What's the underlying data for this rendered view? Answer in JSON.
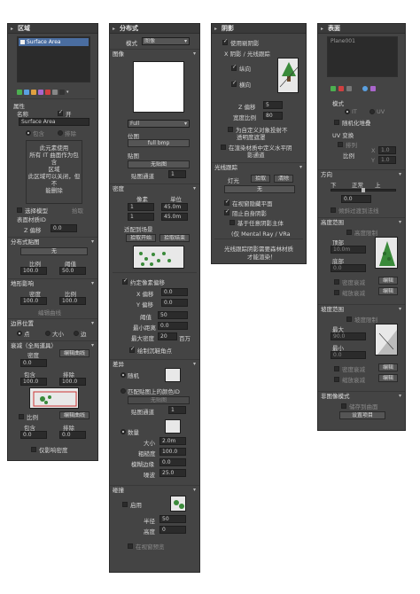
{
  "region": {
    "title": "区域",
    "list_item": "Surface Area",
    "attributes_label": "属性",
    "name_label": "名称",
    "on_label": "开",
    "name_value": "Surface Area",
    "include_label": "包含",
    "exclude_label": "排除",
    "info_lines": [
      "此元素使用",
      "所有 IT 曲面作为包含",
      "区域",
      "",
      "此区域可以关闭，但不",
      "能删除"
    ],
    "select_model_label": "选择模型",
    "pick_label": "拾取",
    "surface_id_label": "表面材质ID",
    "z_offset_label": "Z 偏移",
    "z_offset_value": "0.0",
    "distribution_map_label": "分布式贴图",
    "none_label": "无",
    "scale_label": "比例",
    "threshold_label": "阈值",
    "scale_value": "100.0",
    "threshold_value": "50.0",
    "terrain_influence_label": "地形影响",
    "density_label": "密度",
    "density_value": "100.0",
    "terrain_scale_value": "100.0",
    "edit_curve_label": "编辑曲线",
    "border_position_label": "边界位置",
    "point_label": "点",
    "size_label": "大小",
    "edge_label": "边",
    "falloff_label": "衰减（全局道具）",
    "density2_label": "密度",
    "edit_curve2_label": "编辑曲线",
    "density2_value": "0.0",
    "include2_label": "包含",
    "exclude2_label": "排除",
    "falloff_value": "100.0",
    "scale2_label": "比例",
    "edit_curve3_label": "编辑曲线",
    "include3_label": "包含",
    "exclude3_label": "排除",
    "include3_value": "0.0",
    "exclude3_value": "0.0",
    "affect_density_only_label": "仅影响密度"
  },
  "distribution": {
    "title": "分布式",
    "mode_label": "模式",
    "mode_value": "图像",
    "image_label": "图像",
    "full_label": "Full",
    "bitmap_label": "位图",
    "bitmap_value": "full bmp",
    "map_label": "贴图",
    "none_label": "无贴图",
    "map_channel_label": "贴图通道",
    "map_channel_value": "1",
    "density_section": "密度",
    "pixel_label": "像素",
    "unit_label": "单位",
    "pixel_value": "1",
    "unit_value": "45.0m",
    "pixel2_value": "1",
    "unit2_value": "45.0m",
    "fit_to_scene_label": "适配到场景",
    "pick_start_label": "拾取开始",
    "pick_end_label": "拾取结束",
    "pixel_offset_label": "约定像素偏移",
    "enable_offset_label": "约定像素偏移",
    "x_offset_label": "X 偏移",
    "y_offset_label": "Y 偏移",
    "x_offset_value": "0.0",
    "y_offset_value": "0.0",
    "threshold_label": "阈值",
    "threshold_value": "50",
    "min_dist_label": "最小距离",
    "min_dist_value": "0.0",
    "max_density_label": "最大密度",
    "max_density_value": "20",
    "million_label": "百万",
    "draw_center_label": "绘制沉鞋角点",
    "offset_section": "差异",
    "random_label": "随机",
    "unique_id_label": "匹配贴图上的颜色ID",
    "none2_label": "无贴图",
    "map_channel2_label": "贴图通道",
    "map_channel2_value": "1",
    "count_label": "数量",
    "size_label": "大小",
    "size_value": "2.0m",
    "roughness_label": "粗糙度",
    "roughness_value": "100.0",
    "edge_blend_label": "模糊边缘",
    "edge_blend_value": "0.0",
    "falloff_label": "噪波",
    "falloff_value": "25.0",
    "collision_section": "碰撞",
    "enable_label": "启用",
    "radius_label": "半径",
    "radius_value": "50",
    "height_label": "高度",
    "height_value": "0",
    "preview_label": "在视窗预览"
  },
  "shadow": {
    "title": "阴影",
    "use_shadow_label": "使用剔阴影",
    "xy_shadow_label": "X 阴影 / 光线跟踪",
    "ssao_label": "纵向",
    "blur_label": "横向",
    "z_offset_label": "Z 偏移",
    "z_offset_value": "5",
    "depth_label": "宽度比例",
    "depth_value": "80",
    "auto_label": "为自定义对象投射不",
    "auto_label2": "透明度遮罩",
    "in_material_label": "在渲染材质中定义水平阴",
    "in_material_label2": "影通道",
    "raytrace_label": "光线跟踪",
    "light_label": "灯光",
    "pick_label": "拾取",
    "remove_label": "清除",
    "none_label": "无",
    "receive_label": "在视窗隐藏平面",
    "cast_label": "阻止自身阴影",
    "based_on_label": "基于任意阴影主体",
    "note_label": "(仅 Mental Ray / VRa",
    "info_lines": [
      "光线跟踪阴影需要森林材质",
      "才能渲染！"
    ]
  },
  "surface": {
    "title": "表面",
    "list_item": "Plane001",
    "mode_label": "模式",
    "it_label": "IT",
    "uv_label": "UV",
    "random_label": "随机化堆叠",
    "uv_transform_label": "UV 变换",
    "align_label": "排列",
    "ratio_label": "比例",
    "x_label": "X",
    "y_label": "Y",
    "x_value": "1.0",
    "y_value": "1.0",
    "direction_section": "方向",
    "down_label": "下",
    "normal_label": "正常",
    "up_label": "上",
    "direction_value": "0.0",
    "along_label": "倾斜过渡到法线",
    "altitude_section": "高度范围",
    "altitude_label": "高度限制",
    "top_label": "顶部",
    "top_value": "10.0m",
    "bottom_label": "底部",
    "bottom_value": "0.0",
    "density_falloff_label": "密度衰减",
    "scale_falloff_label": "缩放衰减",
    "edit_label": "编辑",
    "edit2_label": "编辑",
    "slope_section": "坡度范围",
    "slope_label": "坡度限制",
    "max_label": "最大",
    "max_value": "90.0",
    "min_label": "最小",
    "min_value": "0.0",
    "density_falloff2_label": "密度衰减",
    "scale_falloff2_label": "缩放衰减",
    "edit3_label": "编辑",
    "edit4_label": "编辑",
    "nonimage_section": "非图像模式",
    "draw_label": "储存到曲面",
    "set_label": "设置项目"
  }
}
